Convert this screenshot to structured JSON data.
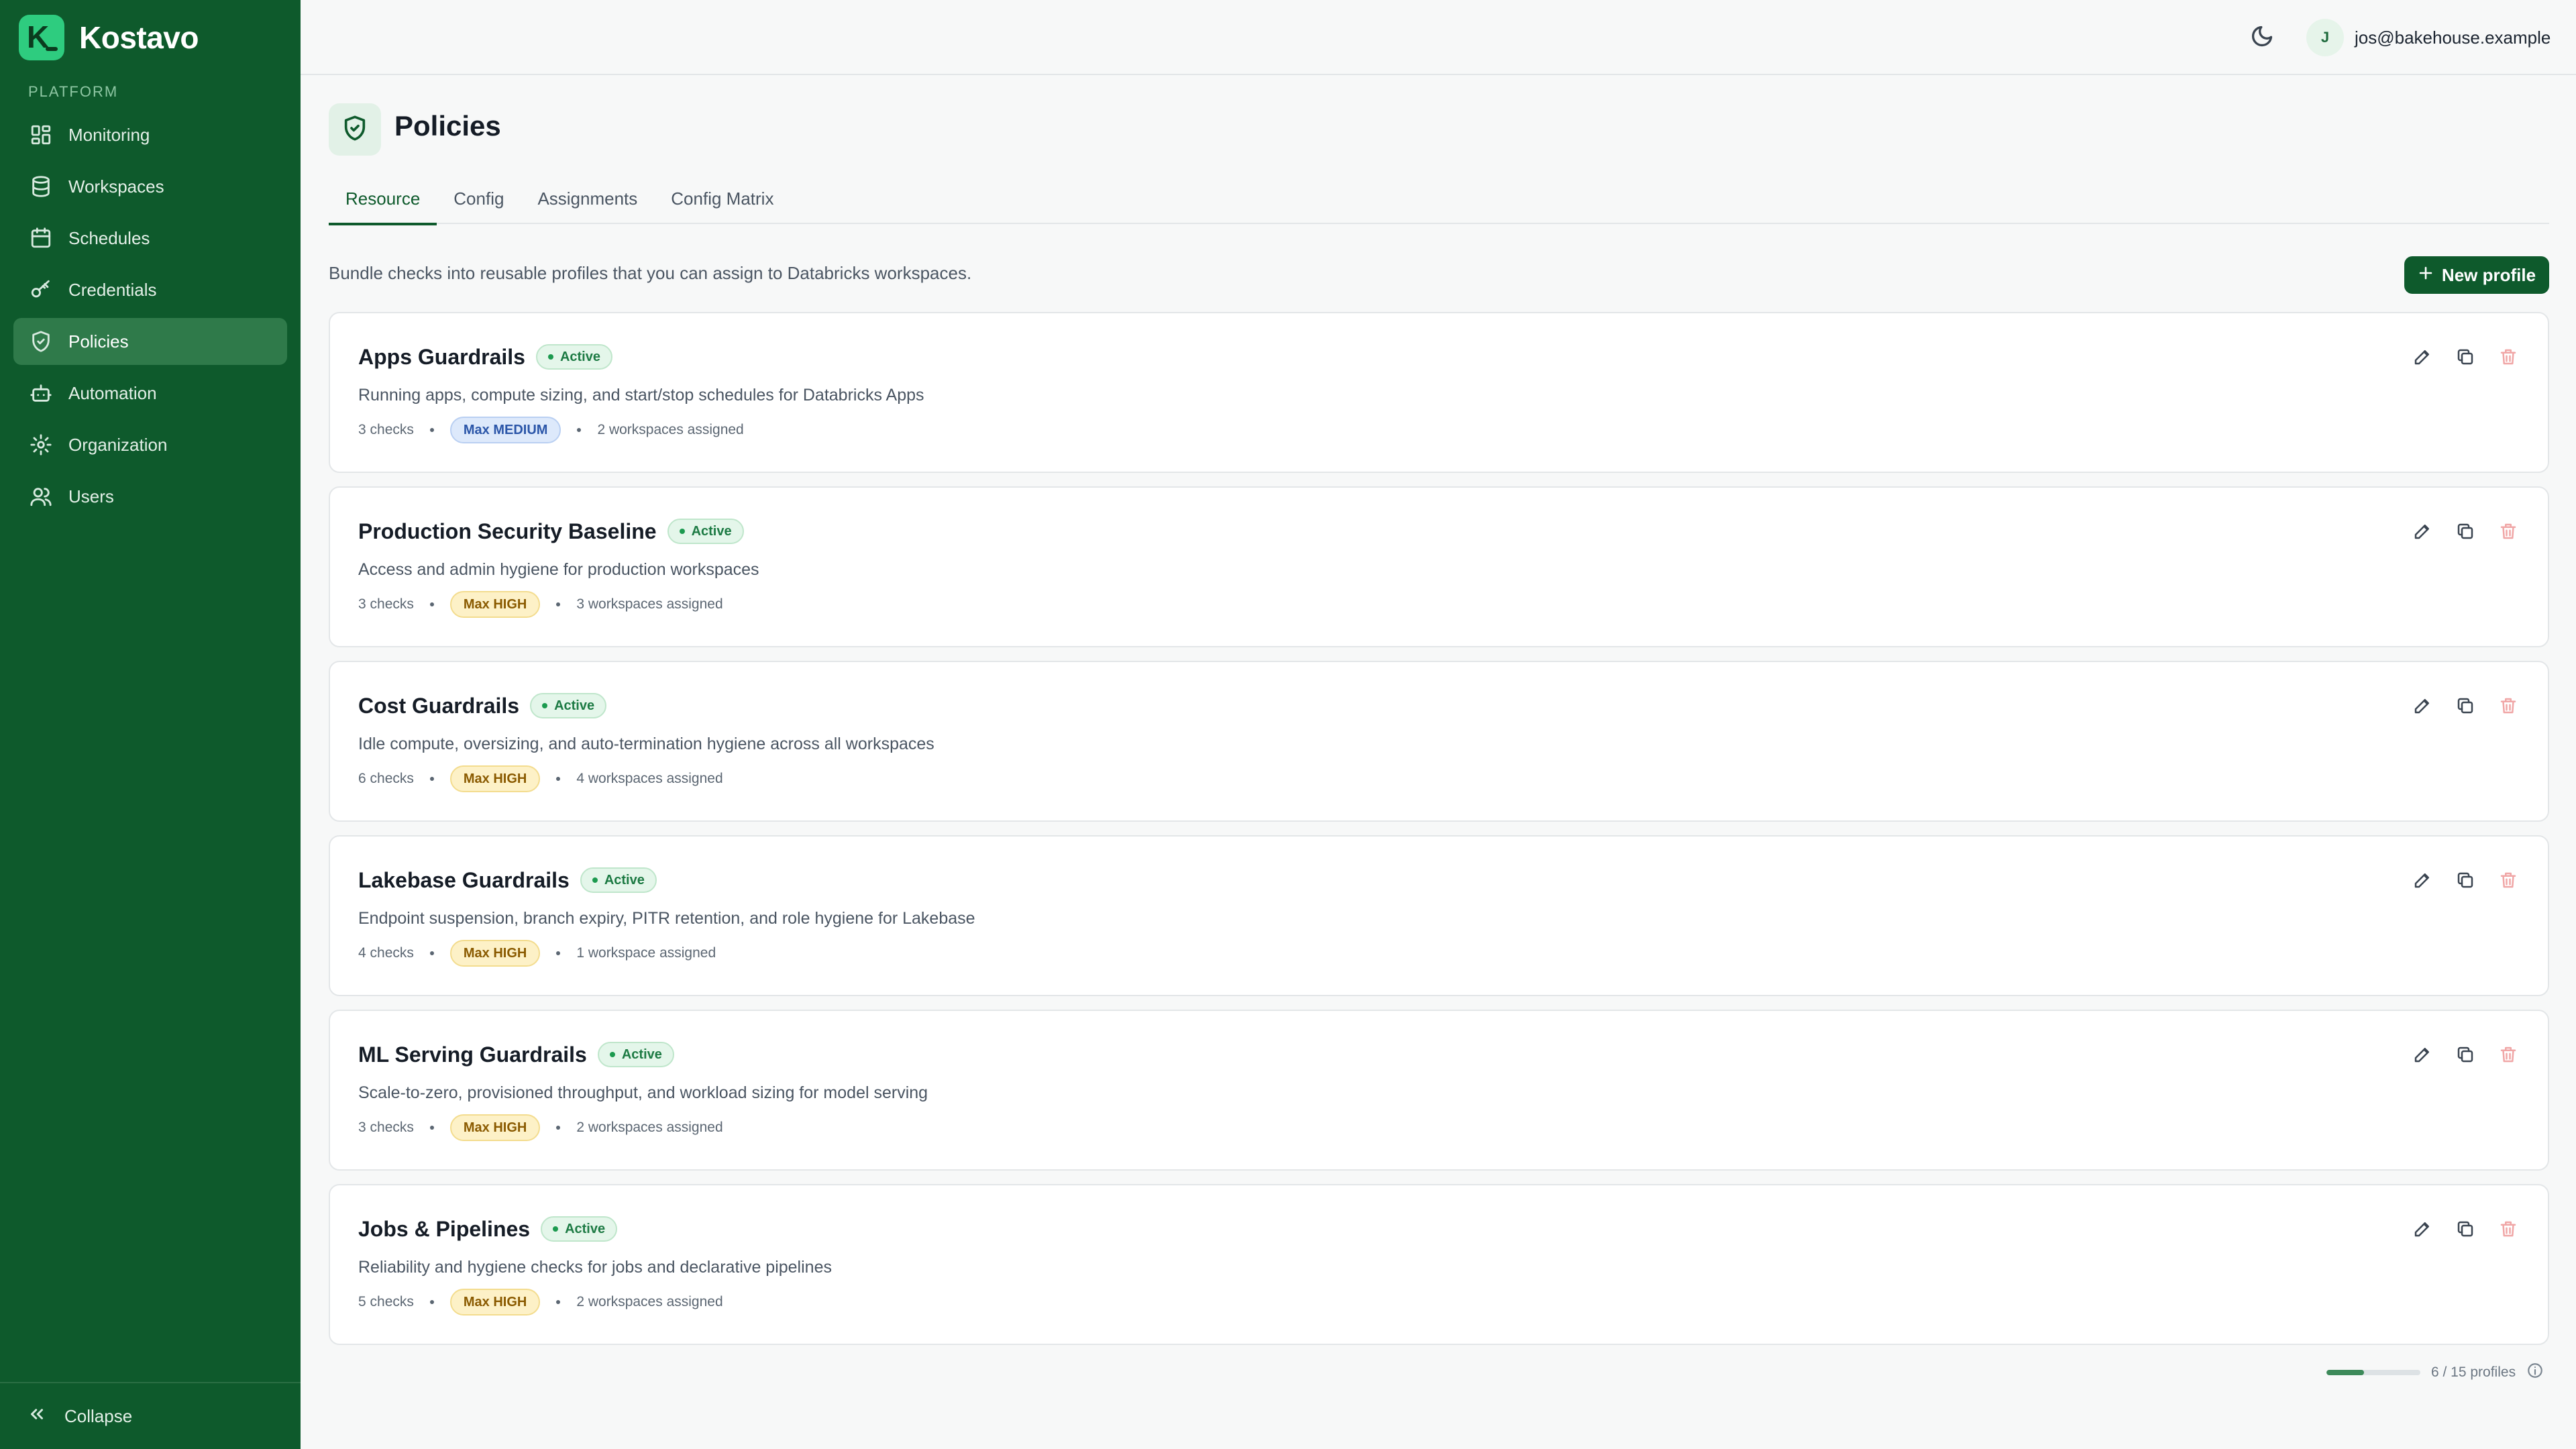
{
  "app": {
    "name": "Kostavo",
    "logo_letter": "K"
  },
  "sidebar": {
    "section_label": "PLATFORM",
    "items": [
      {
        "label": "Monitoring",
        "icon": "grid-icon",
        "active": false
      },
      {
        "label": "Workspaces",
        "icon": "database-icon",
        "active": false
      },
      {
        "label": "Schedules",
        "icon": "calendar-icon",
        "active": false
      },
      {
        "label": "Credentials",
        "icon": "key-icon",
        "active": false
      },
      {
        "label": "Policies",
        "icon": "shield-icon",
        "active": true
      },
      {
        "label": "Automation",
        "icon": "bot-icon",
        "active": false
      },
      {
        "label": "Organization",
        "icon": "gear-icon",
        "active": false
      },
      {
        "label": "Users",
        "icon": "users-icon",
        "active": false
      }
    ],
    "collapse_label": "Collapse"
  },
  "topbar": {
    "theme_icon": "moon-icon",
    "user": {
      "initial": "J",
      "email": "jos@bakehouse.example"
    }
  },
  "page": {
    "title": "Policies",
    "description": "Bundle checks into reusable profiles that you can assign to Databricks workspaces.",
    "new_button_label": "New profile"
  },
  "tabs": [
    {
      "label": "Resource",
      "active": true
    },
    {
      "label": "Config",
      "active": false
    },
    {
      "label": "Assignments",
      "active": false
    },
    {
      "label": "Config Matrix",
      "active": false
    }
  ],
  "profiles": [
    {
      "name": "Apps Guardrails",
      "status": "Active",
      "description": "Running apps, compute sizing, and start/stop schedules for Databricks Apps",
      "checks": "3 checks",
      "severity": "Max MEDIUM",
      "severity_level": "medium",
      "assigned": "2 workspaces assigned"
    },
    {
      "name": "Production Security Baseline",
      "status": "Active",
      "description": "Access and admin hygiene for production workspaces",
      "checks": "3 checks",
      "severity": "Max HIGH",
      "severity_level": "high",
      "assigned": "3 workspaces assigned"
    },
    {
      "name": "Cost Guardrails",
      "status": "Active",
      "description": "Idle compute, oversizing, and auto-termination hygiene across all workspaces",
      "checks": "6 checks",
      "severity": "Max HIGH",
      "severity_level": "high",
      "assigned": "4 workspaces assigned"
    },
    {
      "name": "Lakebase Guardrails",
      "status": "Active",
      "description": "Endpoint suspension, branch expiry, PITR retention, and role hygiene for Lakebase",
      "checks": "4 checks",
      "severity": "Max HIGH",
      "severity_level": "high",
      "assigned": "1 workspace assigned"
    },
    {
      "name": "ML Serving Guardrails",
      "status": "Active",
      "description": "Scale-to-zero, provisioned throughput, and workload sizing for model serving",
      "checks": "3 checks",
      "severity": "Max HIGH",
      "severity_level": "high",
      "assigned": "2 workspaces assigned"
    },
    {
      "name": "Jobs & Pipelines",
      "status": "Active",
      "description": "Reliability and hygiene checks for jobs and declarative pipelines",
      "checks": "5 checks",
      "severity": "Max HIGH",
      "severity_level": "high",
      "assigned": "2 workspaces assigned"
    }
  ],
  "quota": {
    "label": "6 / 15 profiles",
    "used": 6,
    "total": 15
  },
  "colors": {
    "sidebar_bg": "#0e5a2c",
    "accent": "#0e5a2c",
    "active_badge": "#1c7a43",
    "severity_medium_bg": "#dde9fb",
    "severity_medium_fg": "#2a55a8",
    "severity_high_bg": "#fdf1c7",
    "severity_high_fg": "#8a5a00",
    "delete_icon": "#f0a6a6"
  }
}
